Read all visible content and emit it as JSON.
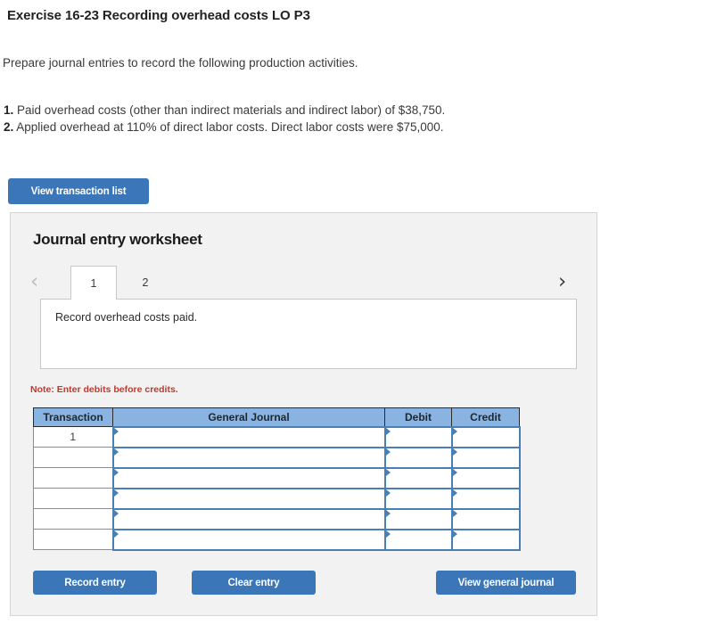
{
  "exercise": {
    "title": "Exercise 16-23 Recording overhead costs LO P3",
    "prompt": "Prepare journal entries to record the following production activities.",
    "activities": [
      {
        "num": "1.",
        "text": "Paid overhead costs (other than indirect materials and indirect labor) of $38,750."
      },
      {
        "num": "2.",
        "text": "Applied overhead at 110% of direct labor costs. Direct labor costs were $75,000."
      }
    ]
  },
  "toolbar": {
    "view_transaction_list_label": "View transaction list"
  },
  "worksheet": {
    "heading": "Journal entry worksheet",
    "prev_chevron": "‹",
    "next_chevron": "›",
    "tabs": [
      {
        "label": "1",
        "active": true
      },
      {
        "label": "2",
        "active": false
      }
    ],
    "description": "Record overhead costs paid.",
    "note": "Note: Enter debits before credits.",
    "table": {
      "columns": [
        "Transaction",
        "General Journal",
        "Debit",
        "Credit"
      ],
      "rows": [
        {
          "transaction": "1",
          "general_journal": "",
          "debit": "",
          "credit": ""
        },
        {
          "transaction": "",
          "general_journal": "",
          "debit": "",
          "credit": ""
        },
        {
          "transaction": "",
          "general_journal": "",
          "debit": "",
          "credit": ""
        },
        {
          "transaction": "",
          "general_journal": "",
          "debit": "",
          "credit": ""
        },
        {
          "transaction": "",
          "general_journal": "",
          "debit": "",
          "credit": ""
        },
        {
          "transaction": "",
          "general_journal": "",
          "debit": "",
          "credit": ""
        }
      ]
    },
    "actions": {
      "record_entry_label": "Record entry",
      "clear_entry_label": "Clear entry",
      "view_general_journal_label": "View general journal"
    }
  },
  "colors": {
    "button_blue": "#3a76b8",
    "table_header_blue": "#89b3e0",
    "input_border_blue": "#4a7fb5",
    "note_red": "#c0392b",
    "panel_gray": "#f2f2f2"
  }
}
